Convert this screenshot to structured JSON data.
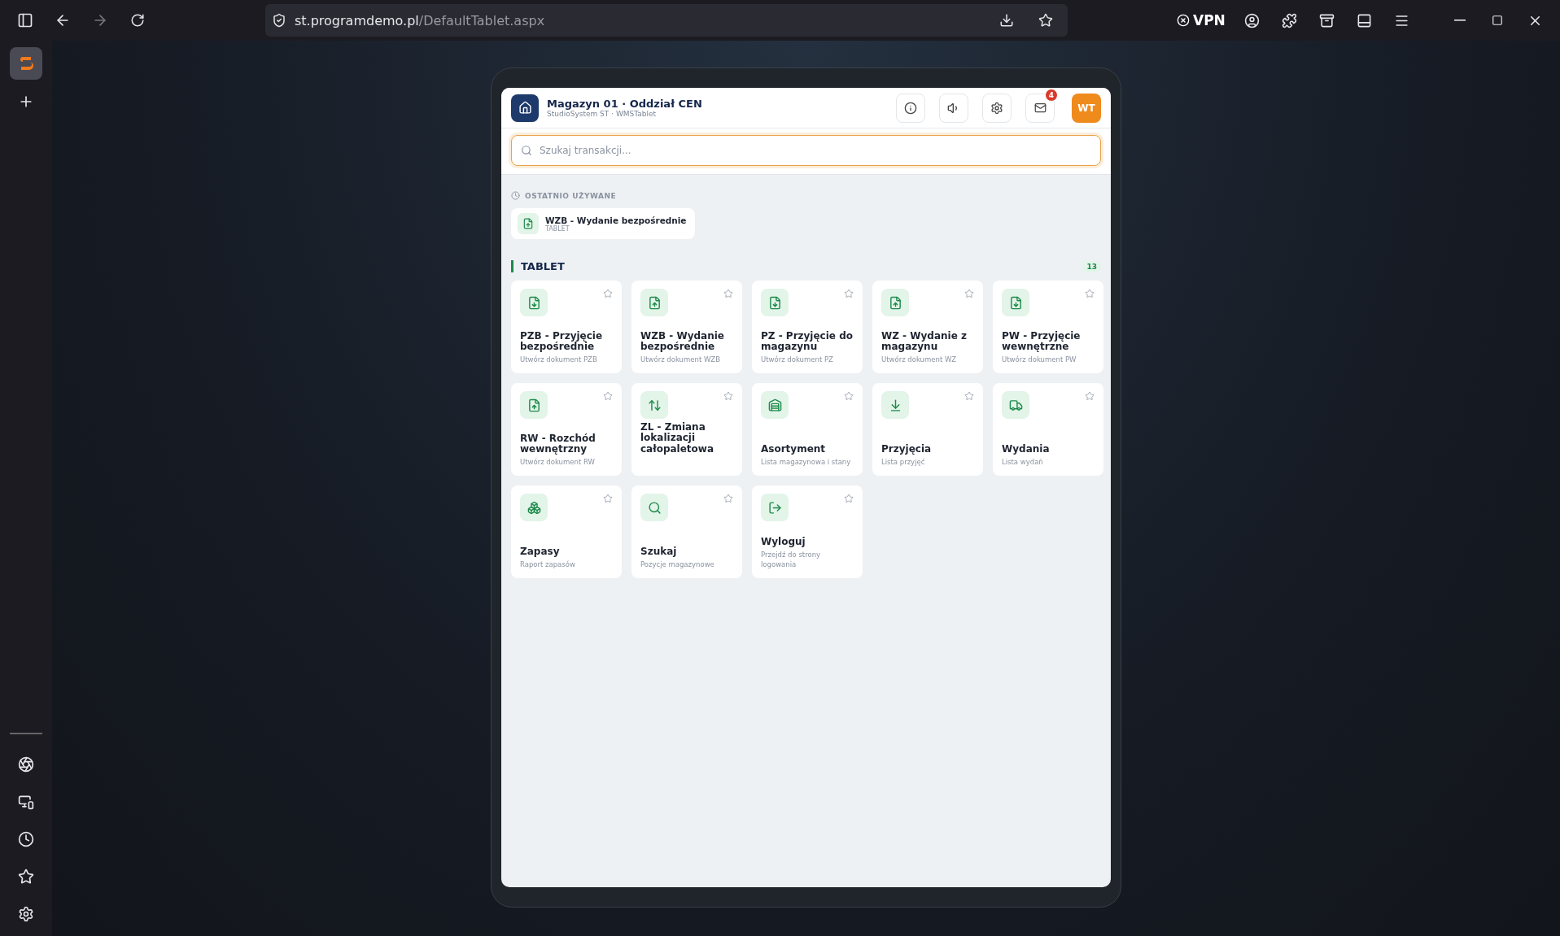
{
  "browser": {
    "url_host": "st.programdemo.pl",
    "url_path": "/DefaultTablet.aspx",
    "vpn_label": "VPN"
  },
  "header": {
    "title": "Magazyn 01 · Oddział CEN",
    "subtitle": "StudioSystem ST · WMSTablet",
    "mail_badge": "4",
    "avatar": "WT"
  },
  "search": {
    "placeholder": "Szukaj transakcji..."
  },
  "recent": {
    "heading": "OSTATNIO UŻYWANE",
    "items": [
      {
        "kind": "file-up",
        "title": "WZB - Wydanie bezpośrednie",
        "subtitle": "TABLET"
      }
    ]
  },
  "section": {
    "title": "TABLET",
    "count": "13"
  },
  "tiles": [
    {
      "kind": "file-down",
      "title": "PZB - Przyjęcie bezpośrednie",
      "subtitle": "Utwórz dokument PZB",
      "starred": false
    },
    {
      "kind": "file-up",
      "title": "WZB - Wydanie bezpośrednie",
      "subtitle": "Utwórz dokument WZB",
      "starred": false
    },
    {
      "kind": "file-down",
      "title": "PZ - Przyjęcie do magazynu",
      "subtitle": "Utwórz dokument PZ",
      "starred": false
    },
    {
      "kind": "file-up",
      "title": "WZ - Wydanie z magazynu",
      "subtitle": "Utwórz dokument WZ",
      "starred": false
    },
    {
      "kind": "file-down",
      "title": "PW - Przyjęcie wewnętrzne",
      "subtitle": "Utwórz dokument PW",
      "starred": false
    },
    {
      "kind": "file-up",
      "title": "RW - Rozchód wewnętrzny",
      "subtitle": "Utwórz dokument RW",
      "starred": false
    },
    {
      "kind": "swap",
      "title": "ZL - Zmiana lokalizacji całopaletowa",
      "starred": false
    },
    {
      "kind": "shelf",
      "title": "Asortyment",
      "subtitle": "Lista magazynowa i stany",
      "starred": false
    },
    {
      "kind": "tray-down",
      "title": "Przyjęcia",
      "subtitle": "Lista przyjęć",
      "starred": false
    },
    {
      "kind": "truck",
      "title": "Wydania",
      "subtitle": "Lista wydań",
      "starred": false
    },
    {
      "kind": "boxes",
      "title": "Zapasy",
      "subtitle": "Raport zapasów",
      "starred": false
    },
    {
      "kind": "search",
      "title": "Szukaj",
      "subtitle": "Pozycje magazynowe",
      "starred": false
    },
    {
      "kind": "logout",
      "title": "Wyloguj",
      "subtitle": "Przejdź do strony logowania",
      "starred": false
    }
  ]
}
